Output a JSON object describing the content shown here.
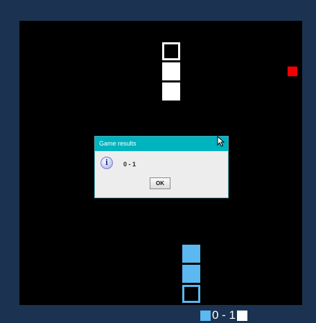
{
  "colors": {
    "frame": "#1b3350",
    "arena": "#000000",
    "player1": "#5bb8f0",
    "player2": "#ffffff",
    "food": "#f00000",
    "dialog_title_bg": "#00b4bf"
  },
  "dialog": {
    "title": "Game results",
    "icon": "info-icon",
    "icon_glyph": "i",
    "message": "0 - 1",
    "ok_label": "OK"
  },
  "scoreboard": {
    "text": "0 - 1",
    "player1_score": 0,
    "player2_score": 1
  }
}
